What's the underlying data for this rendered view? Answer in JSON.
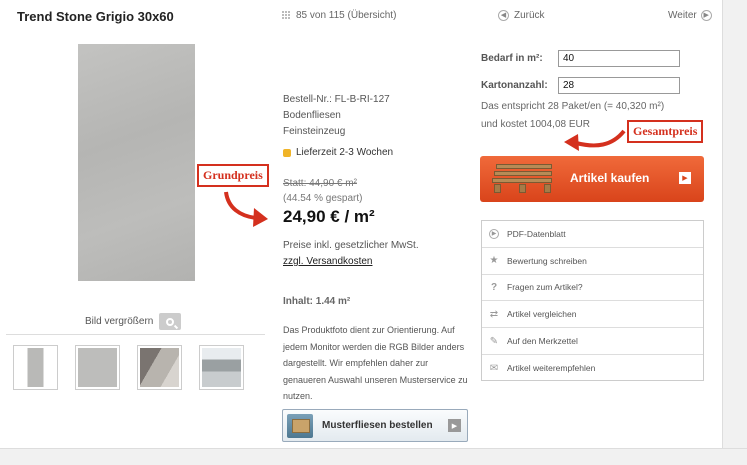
{
  "header": {
    "title": "Trend Stone Grigio 30x60",
    "pager": "85 von 115 (Übersicht)",
    "back_label": "Zurück",
    "next_label": "Weiter"
  },
  "gallery": {
    "zoom_label": "Bild vergrößern"
  },
  "product": {
    "bestell_nr": "Bestell-Nr.: FL-B-RI-127",
    "category": "Bodenfliesen",
    "material": "Feinsteinzeug",
    "lieferzeit": "Lieferzeit 2-3 Wochen",
    "statt": "Statt: 44,90 € m²",
    "gespart": "(44.54 % gespart)",
    "price": "24,90 € / m²",
    "mwst": "Preise inkl. gesetzlicher MwSt.",
    "versand": "zzgl. Versandkosten",
    "inhalt": "Inhalt: 1.44 m²",
    "description": "Das Produktfoto dient zur Orientierung. Auf jedem Monitor werden die RGB Bilder anders dargestellt. Wir empfehlen daher zur genaueren Auswahl unseren Musterservice zu nutzen.",
    "muster_button": "Musterfliesen bestellen"
  },
  "order": {
    "bedarf_label": "Bedarf in m²:",
    "bedarf_value": "40",
    "karton_label": "Kartonanzahl:",
    "karton_value": "28",
    "entspricht": "Das entspricht 28 Paket/en (= 40,320 m²)",
    "kostet": "und kostet 1004,08 EUR",
    "kaufen_label": "Artikel kaufen"
  },
  "actions": [
    {
      "label": "PDF-Datenblatt",
      "icon": "pdf-icon"
    },
    {
      "label": "Bewertung schreiben",
      "icon": "star-icon"
    },
    {
      "label": "Fragen zum Artikel?",
      "icon": "question-icon"
    },
    {
      "label": "Artikel vergleichen",
      "icon": "compare-icon"
    },
    {
      "label": "Auf den Merkzettel",
      "icon": "notepad-icon"
    },
    {
      "label": "Artikel weiterempfehlen",
      "icon": "recommend-icon"
    }
  ],
  "annotations": {
    "grundpreis": "Grundpreis",
    "gesamtpreis": "Gesamtpreis"
  },
  "colors": {
    "buy_button": "#e05425",
    "annotation": "#d4301e",
    "lieferzeit_dot": "#f0b428"
  }
}
